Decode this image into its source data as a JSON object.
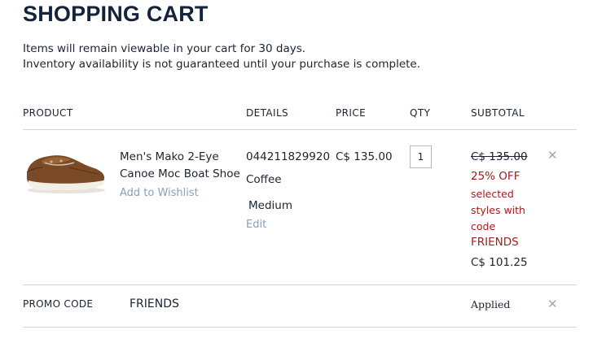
{
  "page": {
    "title": "SHOPPING CART",
    "notice_line1": "Items will remain viewable in your cart for 30 days.",
    "notice_line2": "Inventory availability is not guaranteed until your purchase is complete."
  },
  "table_headers": {
    "product": "PRODUCT",
    "details": "DETAILS",
    "price": "PRICE",
    "qty": "QTY",
    "subtotal": "SUBTOTAL"
  },
  "cart_item": {
    "image_alt": "brown boat shoe",
    "name_line1": "Men's Mako 2-Eye",
    "name_line2": "Canoe Moc Boat Shoe",
    "wishlist_label": "Add to Wishlist",
    "sku": "044211829920",
    "color": "Coffee",
    "width": "Medium",
    "edit_label": "Edit",
    "price": "C$ 135.00",
    "quantity": "1",
    "original_subtotal": "C$ 135.00",
    "promo_lines": [
      "25% OFF",
      "selected",
      "styles with",
      "code",
      "FRIENDS"
    ],
    "final_subtotal": "C$ 101.25",
    "remove_icon": "close-icon"
  },
  "promo_code": {
    "label": "PROMO CODE",
    "code": "FRIENDS",
    "status": "Applied",
    "remove_icon": "close-icon"
  },
  "colors": {
    "title": "#13233a",
    "link": "#8aa0b4",
    "promo_red": "#a01f1f",
    "divider": "#d4d4d4"
  }
}
